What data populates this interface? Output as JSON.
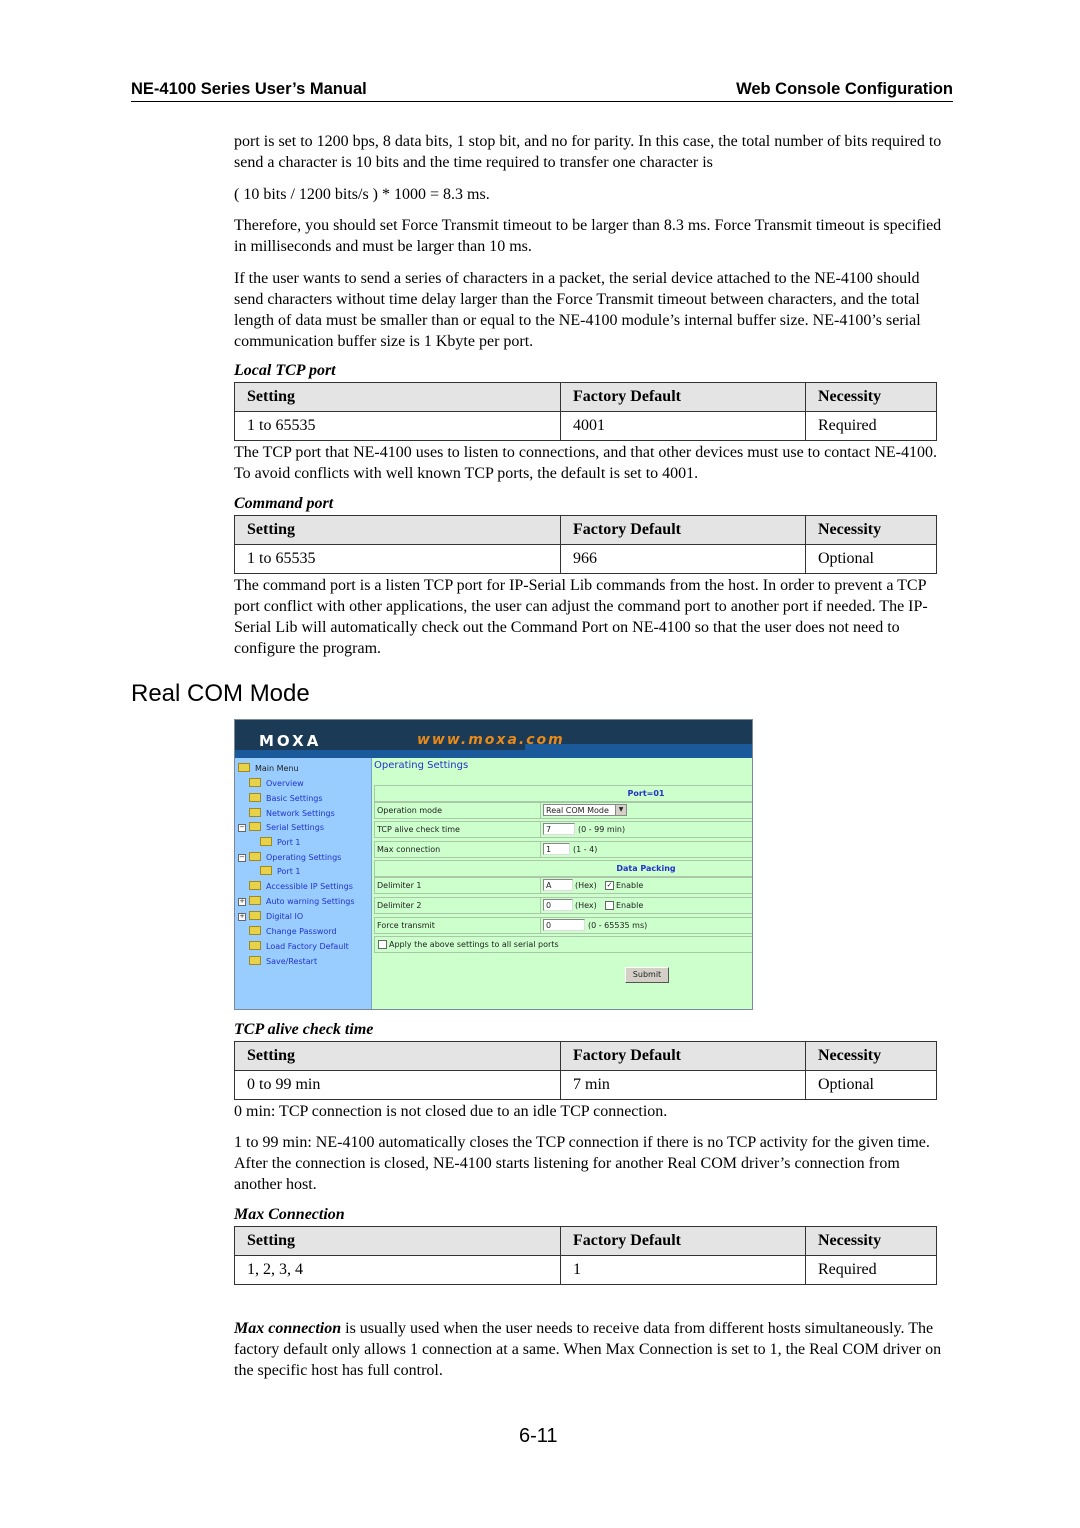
{
  "header": {
    "left": "NE-4100 Series User’s Manual",
    "right": "Web Console Configuration"
  },
  "intro": {
    "p1": "port is set to 1200 bps, 8 data bits, 1 stop bit, and no for parity. In this case, the total number of bits required to send a character is 10 bits and the time required to transfer one character is",
    "p2": "( 10 bits / 1200 bits/s ) * 1000 = 8.3 ms.",
    "p3": "Therefore, you should set Force Transmit timeout to be larger than 8.3 ms. Force Transmit timeout is specified in milliseconds and must be larger than 10 ms.",
    "p4": "If the user wants to send a series of characters in a packet, the serial device attached to the NE-4100 should send characters without time delay larger than the Force Transmit timeout between characters, and the total length of data must be smaller than or equal to the NE-4100 module’s internal buffer size. NE-4100’s serial communication buffer size is 1 Kbyte per port."
  },
  "table_headers": {
    "setting": "Setting",
    "default": "Factory Default",
    "necessity": "Necessity"
  },
  "local_tcp_port": {
    "caption": "Local TCP port",
    "setting": "1 to 65535",
    "default": "4001",
    "necessity": "Required",
    "description": "The TCP port that NE-4100 uses to listen to connections, and that other devices must use to contact NE-4100. To avoid conflicts with well known TCP ports, the default is set to 4001."
  },
  "command_port": {
    "caption": "Command port",
    "setting": "1 to 65535",
    "default": "966",
    "necessity": "Optional",
    "description": "The command port is a listen TCP port for IP-Serial Lib commands from the host. In order to prevent a TCP port conflict with other applications, the user can adjust the command port to another port if needed. The IP-Serial Lib will automatically check out the Command Port on NE-4100 so that the user does not need to configure the program."
  },
  "section_title": "Real COM Mode",
  "console": {
    "logo": "MOXA",
    "url": "www.moxa.com",
    "menu": [
      {
        "label": "Main Menu"
      },
      {
        "label": "Overview"
      },
      {
        "label": "Basic Settings"
      },
      {
        "label": "Network Settings"
      },
      {
        "label": "Serial Settings"
      },
      {
        "label": "Port 1"
      },
      {
        "label": "Operating Settings"
      },
      {
        "label": "Port 1"
      },
      {
        "label": "Accessible IP Settings"
      },
      {
        "label": "Auto warning Settings"
      },
      {
        "label": "Digital IO"
      },
      {
        "label": "Change Password"
      },
      {
        "label": "Load Factory Default"
      },
      {
        "label": "Save/Restart"
      }
    ],
    "title": "Operating Settings",
    "port_header": "Port=01",
    "operation_mode": {
      "label": "Operation mode",
      "value": "Real COM Mode"
    },
    "tcp_alive": {
      "label": "TCP alive check time",
      "value": "7",
      "hint": "(0 - 99 min)"
    },
    "max_connection": {
      "label": "Max connection",
      "value": "1",
      "hint": "(1 - 4)"
    },
    "data_packing_header": "Data Packing",
    "delimiter1": {
      "label": "Delimiter 1",
      "value": "A",
      "hint": "(Hex)",
      "enable_label": "Enable",
      "enabled": true
    },
    "delimiter2": {
      "label": "Delimiter 2",
      "value": "0",
      "hint": "(Hex)",
      "enable_label": "Enable",
      "enabled": false
    },
    "force_transmit": {
      "label": "Force transmit",
      "value": "0",
      "hint": "(0 - 65535 ms)"
    },
    "apply_all": {
      "label": "Apply the above settings to all serial ports",
      "checked": false
    },
    "submit": "Submit"
  },
  "tcp_alive_check": {
    "caption": "TCP alive check time",
    "setting": "0 to 99 min",
    "default": "7 min",
    "necessity": "Optional",
    "desc1": "0 min: TCP connection is not closed due to an idle TCP connection.",
    "desc2": "1 to 99 min: NE-4100 automatically closes the TCP connection if there is no TCP activity for the given time. After the connection is closed, NE-4100 starts listening for another Real COM driver’s connection from another host."
  },
  "max_connection": {
    "caption": "Max Connection",
    "setting": "1, 2, 3, 4",
    "default": "1",
    "necessity": "Required",
    "desc_emphasis": "Max connection",
    "desc_rest": " is usually used when the user needs to receive data from different hosts simultaneously. The factory default only allows 1 connection at a same. When Max Connection is set to 1, the Real COM driver on the specific host has full control."
  },
  "page_number": "6-11"
}
